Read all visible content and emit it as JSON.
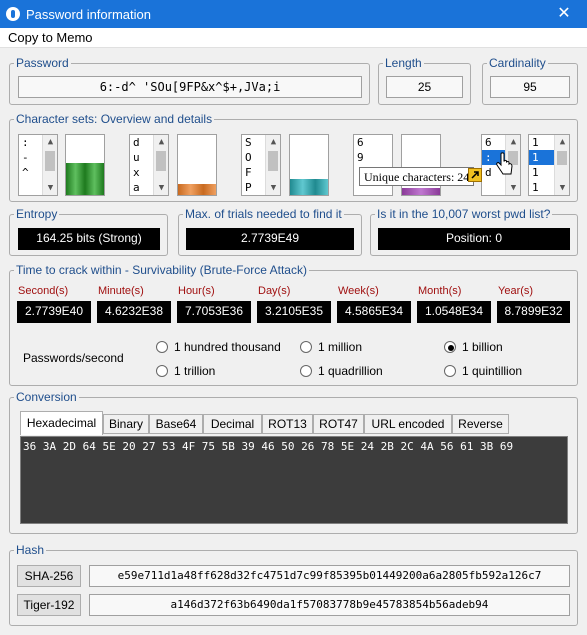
{
  "window": {
    "title": "Password information",
    "close_glyph": "✕"
  },
  "menu": {
    "copy_to_memo": "Copy to Memo"
  },
  "password": {
    "label": "Password",
    "value": "6:-d^ 'SOu[9FP&x^$+,JVa;i"
  },
  "length": {
    "label": "Length",
    "value": "25"
  },
  "cardinality": {
    "label": "Cardinality",
    "value": "95"
  },
  "charsets": {
    "label": "Character sets: Overview and details",
    "lists": [
      {
        "rows": [
          ":",
          "-",
          "^"
        ],
        "selected": -1
      },
      {
        "rows": [
          "d",
          "u",
          "x",
          "a"
        ],
        "selected": -1
      },
      {
        "rows": [
          "S",
          "O",
          "F",
          "P"
        ],
        "selected": -1
      },
      {
        "rows": [
          "6",
          "9"
        ],
        "selected": -1
      },
      {
        "rows": [
          "6",
          ":",
          "d"
        ],
        "selected": 1
      },
      {
        "rows": [
          "1",
          "1",
          "1",
          "1"
        ],
        "selected": 1
      }
    ],
    "tooltip": "Unique characters: 24",
    "colors": {
      "symbols": "#3a9a3a",
      "lower": "#d98030",
      "upper": "#30a0a8",
      "digits": "#9a4aa8"
    }
  },
  "entropy": {
    "label": "Entropy",
    "value": "164.25 bits (Strong)"
  },
  "max_trials": {
    "label": "Max. of trials needed to find it",
    "value": "2.7739E49"
  },
  "worst_list": {
    "label": "Is it in the 10,007 worst pwd list?",
    "value": "Position: 0"
  },
  "crack": {
    "label": "Time to crack within - Survivability (Brute-Force Attack)",
    "units": [
      {
        "name": "Second(s)",
        "value": "2.7739E40"
      },
      {
        "name": "Minute(s)",
        "value": "4.6232E38"
      },
      {
        "name": "Hour(s)",
        "value": "7.7053E36"
      },
      {
        "name": "Day(s)",
        "value": "3.2105E35"
      },
      {
        "name": "Week(s)",
        "value": "4.5865E34"
      },
      {
        "name": "Month(s)",
        "value": "1.0548E34"
      },
      {
        "name": "Year(s)",
        "value": "8.7899E32"
      }
    ],
    "pps_label": "Passwords/second",
    "rates": [
      "1 hundred thousand",
      "1 million",
      "1 billion",
      "1 trillion",
      "1 quadrillion",
      "1 quintillion"
    ],
    "selected_rate": "1 billion"
  },
  "conversion": {
    "label": "Conversion",
    "tabs": [
      "Hexadecimal",
      "Binary",
      "Base64",
      "Decimal",
      "ROT13",
      "ROT47",
      "URL encoded",
      "Reverse"
    ],
    "active_tab": "Hexadecimal",
    "output": "36 3A 2D 64 5E 20 27 53 4F 75 5B 39 46 50 26 78 5E 24 2B 2C 4A 56 61 3B 69"
  },
  "hash": {
    "label": "Hash",
    "rows": [
      {
        "name": "SHA-256",
        "value": "e59e711d1a48ff628d32fc4751d7c99f85395b01449200a6a2805fb592a126c7"
      },
      {
        "name": "Tiger-192",
        "value": "a146d372f63b6490da1f57083778b9e45783854b56adeb94"
      }
    ]
  }
}
